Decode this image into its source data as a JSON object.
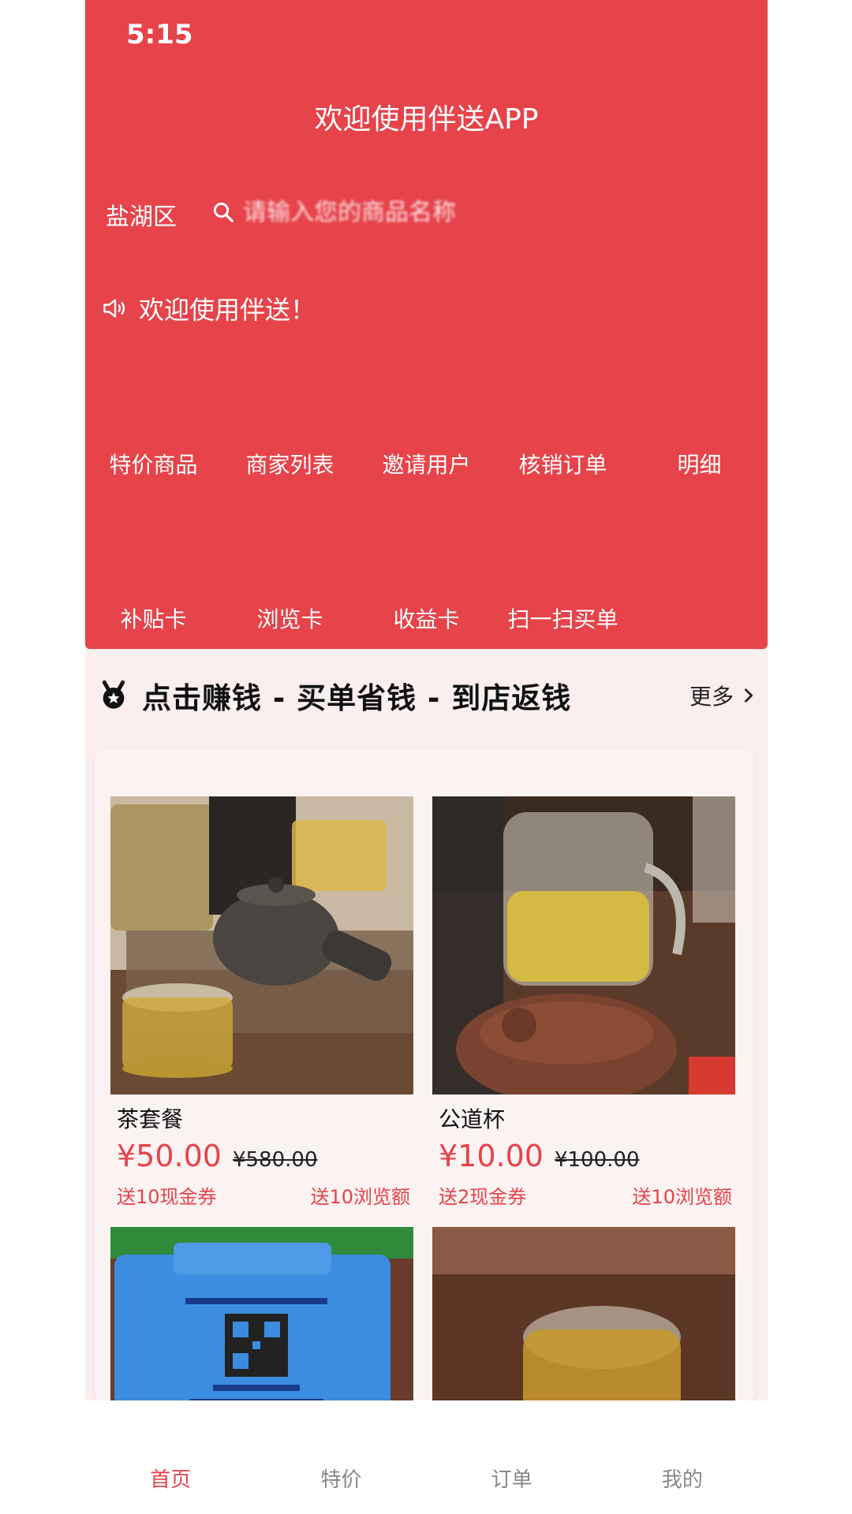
{
  "status_bar": {
    "time": "5:15"
  },
  "header": {
    "title": "欢迎使用伴送APP",
    "location": "盐湖区",
    "search_placeholder": "请输入您的商品名称",
    "notice": "欢迎使用伴送！"
  },
  "menu": {
    "row1": [
      "特价商品",
      "商家列表",
      "邀请用户",
      "核销订单",
      "明细"
    ],
    "row2": [
      "补贴卡",
      "浏览卡",
      "收益卡",
      "扫一扫买单"
    ]
  },
  "section": {
    "title": "点击赚钱 - 买单省钱 - 到店返钱",
    "more": "更多"
  },
  "products": [
    {
      "name": "茶套餐",
      "price": "¥50.00",
      "original_price": "¥580.00",
      "coupon": "送10现金券",
      "browse": "送10浏览额"
    },
    {
      "name": "公道杯",
      "price": "¥10.00",
      "original_price": "¥100.00",
      "coupon": "送2现金券",
      "browse": "送10浏览额"
    }
  ],
  "tabbar": [
    "首页",
    "特价",
    "订单",
    "我的"
  ],
  "colors": {
    "accent": "#e6434a",
    "background": "#fbeeee"
  }
}
